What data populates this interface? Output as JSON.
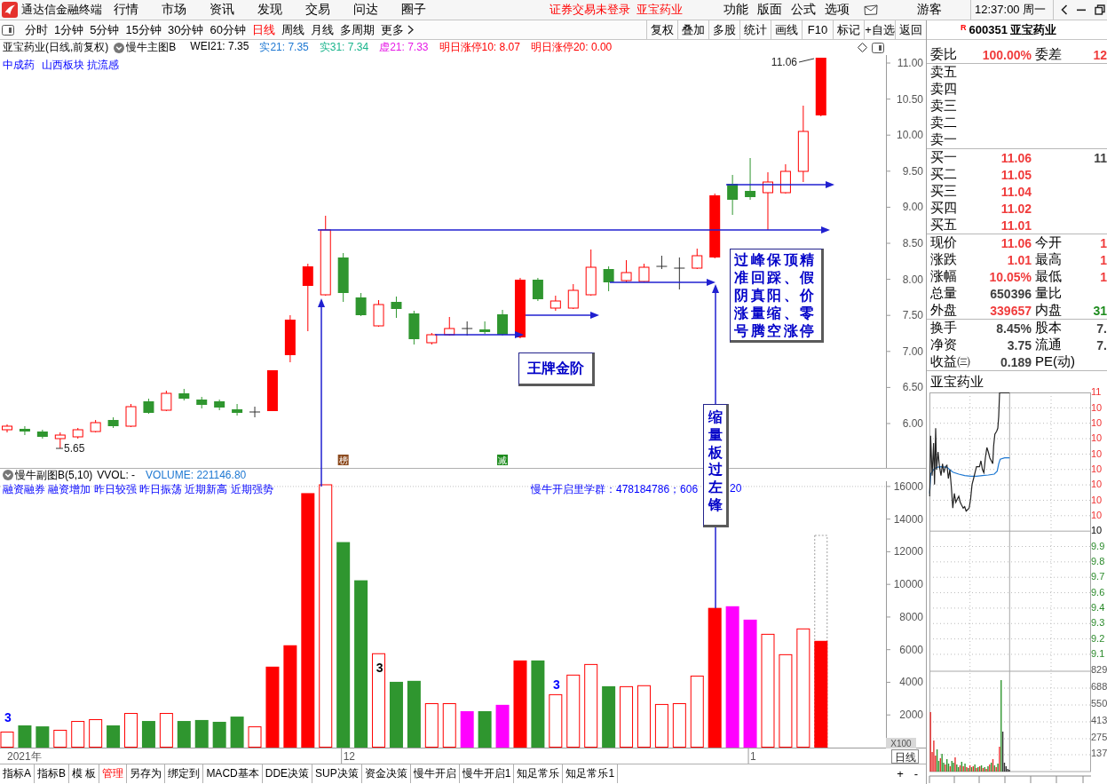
{
  "title_bar": {
    "app_name": "通达信金融终端",
    "menu": [
      "行情",
      "市场",
      "资讯",
      "发现",
      "交易",
      "问达",
      "圈子"
    ],
    "notices": [
      "证券交易未登录",
      "亚宝药业"
    ],
    "tools": [
      "功能",
      "版面",
      "公式",
      "选项"
    ],
    "user": "游客",
    "clock": "12:37:00 周一"
  },
  "period_bar": {
    "periods": [
      {
        "label": "分时",
        "kind": "period",
        "selected": false
      },
      {
        "label": "1分钟",
        "kind": "period",
        "selected": false
      },
      {
        "label": "5分钟",
        "kind": "period",
        "selected": false
      },
      {
        "label": "15分钟",
        "kind": "period",
        "selected": false
      },
      {
        "label": "30分钟",
        "kind": "period",
        "selected": false
      },
      {
        "label": "60分钟",
        "kind": "period",
        "selected": false
      },
      {
        "label": "日线",
        "kind": "period",
        "selected": true
      },
      {
        "label": "周线",
        "kind": "period",
        "selected": false
      },
      {
        "label": "月线",
        "kind": "period",
        "selected": false
      },
      {
        "label": "多周期",
        "kind": "period",
        "selected": false
      },
      {
        "label": "更多",
        "kind": "more",
        "selected": false
      }
    ],
    "buttons": [
      "复权",
      "叠加",
      "多股",
      "统计",
      "画线",
      "F10",
      "标记",
      "+自选",
      "返回"
    ]
  },
  "price_panel": {
    "title": "亚宝药业(日线,前复权)",
    "indicator": "慢牛主图B",
    "readings": [
      {
        "text": "WEI21: 7.35",
        "color": "#000000"
      },
      {
        "text": "实21: 7.35",
        "color": "#1e78d2"
      },
      {
        "text": "实31: 7.34",
        "color": "#19b48c"
      },
      {
        "text": "虚21: 7.33",
        "color": "#e619e6"
      },
      {
        "text": "明日涨停10: 8.07",
        "color": "#ff0000"
      },
      {
        "text": "明日涨停20: 0.00",
        "color": "#ff0000"
      }
    ],
    "tags": [
      "中成药",
      "山西板块 抗流感"
    ],
    "axis_labels": [
      "11.00",
      "10.50",
      "10.00",
      "9.50",
      "9.00",
      "8.50",
      "8.00",
      "7.50",
      "7.00",
      "6.50",
      "6.00"
    ],
    "high_label": "11.06",
    "low_label": "5.65",
    "markers": [
      {
        "text": "榜",
        "color": "#8c4a1e"
      },
      {
        "text": "减",
        "color": "#1e8c1e"
      }
    ],
    "annotations": [
      {
        "text": "王牌金阶",
        "kind": "horizontal"
      },
      {
        "text": "过峰保顶精准回踩、假阴真阳、价涨量缩、零号腾空涨停",
        "kind": "block"
      },
      {
        "text": "缩量板过左锋",
        "kind": "vertical"
      }
    ]
  },
  "volume_panel": {
    "indicator": "慢牛副图B(5,10)",
    "readings": [
      {
        "text": "VVOL: -",
        "color": "#000000"
      },
      {
        "text": "VOLUME: 221146.80",
        "color": "#1e78d2"
      }
    ],
    "signals": "融资融券 融资增加 昨日较强 昨日振荡 近期新高 近期强势",
    "notice": [
      "慢牛开启里学群：478184786；606",
      "20"
    ],
    "axis_labels": [
      "16000",
      "14000",
      "12000",
      "10000",
      "8000",
      "6000",
      "4000",
      "2000"
    ],
    "unit": "X100",
    "date_labels": [
      "2021年",
      "12",
      "1"
    ],
    "period": "日线",
    "bar_labels": [
      {
        "text": "3",
        "color": "#0000ff"
      },
      {
        "text": "3",
        "color": "#000000"
      },
      {
        "text": "3",
        "color": "#0000ff"
      }
    ]
  },
  "template_tabs": [
    {
      "label": "指标A",
      "selected": false
    },
    {
      "label": "指标B",
      "selected": false
    },
    {
      "label": "模 板",
      "selected": false
    },
    {
      "label": "管理",
      "selected": true
    },
    {
      "label": "另存为",
      "selected": false
    },
    {
      "label": "绑定到",
      "selected": false
    },
    {
      "label": "MACD基本",
      "selected": false
    },
    {
      "label": "DDE决策",
      "selected": false
    },
    {
      "label": "SUP决策",
      "selected": false
    },
    {
      "label": "资金决策",
      "selected": false
    },
    {
      "label": "慢牛开启",
      "selected": false
    },
    {
      "label": "慢牛开启1",
      "selected": false
    },
    {
      "label": "知足常乐",
      "selected": false
    },
    {
      "label": "知足常乐1",
      "selected": false
    }
  ],
  "zoom_buttons": [
    "+",
    "-"
  ],
  "quote_panel": {
    "market": "R",
    "code": "600351",
    "name": "亚宝药业",
    "summary": [
      {
        "label": "委比",
        "value": {
          "text": "100.00%",
          "color": "#f03c3c"
        },
        "label2": "委差",
        "value2": {
          "text": "12",
          "color": "#f03c3c"
        }
      }
    ],
    "asks": [
      {
        "label": "卖五"
      },
      {
        "label": "卖四"
      },
      {
        "label": "卖三"
      },
      {
        "label": "卖二"
      },
      {
        "label": "卖一"
      }
    ],
    "bids": [
      {
        "label": "买一",
        "value": {
          "text": "11.06",
          "color": "#f03c3c"
        },
        "value2": {
          "text": "11",
          "color": "#404040"
        }
      },
      {
        "label": "买二",
        "value": {
          "text": "11.05",
          "color": "#f03c3c"
        }
      },
      {
        "label": "买三",
        "value": {
          "text": "11.04",
          "color": "#f03c3c"
        }
      },
      {
        "label": "买四",
        "value": {
          "text": "11.02",
          "color": "#f03c3c"
        }
      },
      {
        "label": "买五",
        "value": {
          "text": "11.01",
          "color": "#f03c3c"
        }
      }
    ],
    "stats": [
      {
        "label": "现价",
        "value": {
          "text": "11.06",
          "color": "#f03c3c"
        },
        "label2": "今开",
        "value2": {
          "text": "1",
          "color": "#f03c3c"
        }
      },
      {
        "label": "涨跌",
        "value": {
          "text": "1.01",
          "color": "#f03c3c"
        },
        "label2": "最高",
        "value2": {
          "text": "1",
          "color": "#f03c3c"
        }
      },
      {
        "label": "涨幅",
        "value": {
          "text": "10.05%",
          "color": "#f03c3c"
        },
        "label2": "最低",
        "value2": {
          "text": "1",
          "color": "#f03c3c"
        }
      },
      {
        "label": "总量",
        "value": {
          "text": "650396",
          "color": "#404040"
        },
        "label2": "量比"
      },
      {
        "label": "外盘",
        "value": {
          "text": "339657",
          "color": "#f03c3c"
        },
        "label2": "内盘",
        "value2": {
          "text": "31",
          "color": "#1e8c1e"
        }
      }
    ],
    "fundamentals": [
      {
        "label": "换手",
        "value": {
          "text": "8.45%",
          "color": "#404040"
        },
        "label2": "股本",
        "value2": {
          "text": "7.",
          "color": "#404040"
        }
      },
      {
        "label": "净资",
        "value": {
          "text": "3.75",
          "color": "#404040"
        },
        "label2": "流通",
        "value2": {
          "text": "7.",
          "color": "#404040"
        }
      },
      {
        "label": "收益㈢",
        "value": {
          "text": "0.189",
          "color": "#404040"
        },
        "label2": "PE(动)"
      }
    ]
  },
  "intraday": {
    "title": "亚宝药业",
    "labels": [
      {
        "text": "11",
        "kind": "up"
      },
      {
        "text": "10",
        "kind": "up"
      },
      {
        "text": "10",
        "kind": "up"
      },
      {
        "text": "10",
        "kind": "up"
      },
      {
        "text": "10",
        "kind": "up"
      },
      {
        "text": "10",
        "kind": "up"
      },
      {
        "text": "10",
        "kind": "up"
      },
      {
        "text": "10",
        "kind": "up"
      },
      {
        "text": "10",
        "kind": "up"
      },
      {
        "text": "10",
        "kind": "flat"
      },
      {
        "text": "9.9",
        "kind": "down"
      },
      {
        "text": "9.8",
        "kind": "down"
      },
      {
        "text": "9.7",
        "kind": "down"
      },
      {
        "text": "9.6",
        "kind": "down"
      },
      {
        "text": "9.4",
        "kind": "down"
      },
      {
        "text": "9.3",
        "kind": "down"
      },
      {
        "text": "9.2",
        "kind": "down"
      },
      {
        "text": "9.1",
        "kind": "down"
      },
      {
        "text": "829",
        "kind": "volume"
      },
      {
        "text": "688",
        "kind": "volume"
      },
      {
        "text": "550",
        "kind": "volume"
      },
      {
        "text": "413",
        "kind": "volume"
      },
      {
        "text": "275",
        "kind": "volume"
      },
      {
        "text": "137",
        "kind": "volume"
      }
    ]
  }
}
